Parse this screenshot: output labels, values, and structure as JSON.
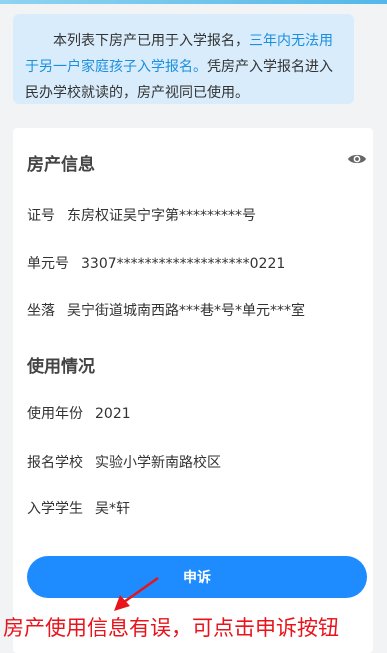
{
  "notice": {
    "part1": "本列表下房产已用于入学报名，",
    "highlight": "三年内无法用于另一户家庭孩子入学报名。",
    "part2": "凭房产入学报名进入民办学校就读的，房产视同已使用。"
  },
  "property_info": {
    "title": "房产信息",
    "fields": [
      {
        "label": "证号",
        "value": "东房权证吴宁字第*********号"
      },
      {
        "label": "单元号",
        "value": "3307*******************0221"
      },
      {
        "label": "坐落",
        "value": "吴宁街道城南西路***巷*号*单元***室"
      }
    ]
  },
  "usage_info": {
    "title": "使用情况",
    "fields": [
      {
        "label": "使用年份",
        "value": "2021"
      },
      {
        "label": "报名学校",
        "value": "实验小学新南路校区"
      },
      {
        "label": "入学学生",
        "value": "吴*轩"
      }
    ]
  },
  "appeal_button": "申诉",
  "annotation": "房产使用信息有误，可点击申诉按钮",
  "colors": {
    "accent": "#1e8bff",
    "highlight": "#1a8fe0",
    "annotation": "#e8141b",
    "notice_bg": "#d9ecfb"
  },
  "icons": {
    "visibility": "eye-icon"
  }
}
